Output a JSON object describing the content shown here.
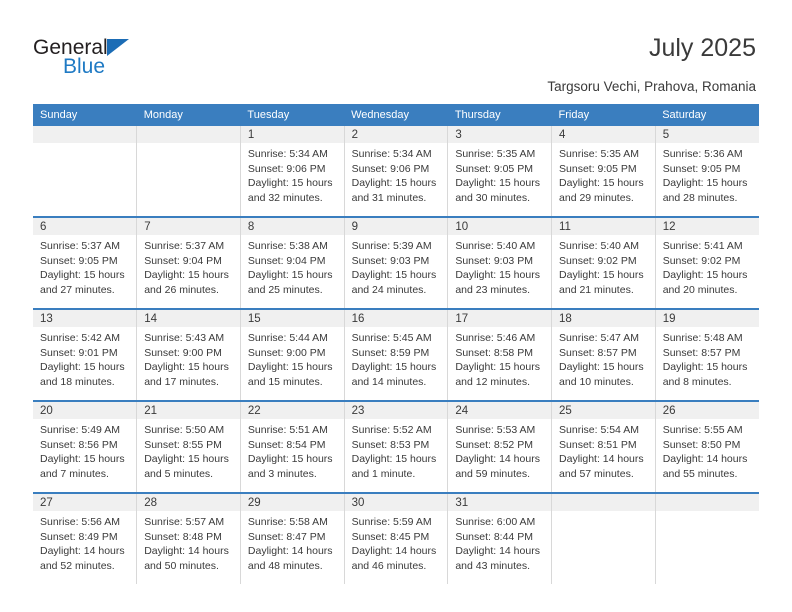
{
  "brand": {
    "name_part1": "General",
    "name_part2": "Blue",
    "triangle_color": "#1b6cb5",
    "blue_color": "#1f7ac4"
  },
  "header": {
    "title": "July 2025",
    "subtitle": "Targsoru Vechi, Prahova, Romania"
  },
  "theme": {
    "header_row_bg": "#3a7ebf",
    "daynum_band_bg": "#f0f0f0",
    "week_separator": "#3a7ebf",
    "cell_border": "#d8d8d8",
    "text_color": "#3a3a3a"
  },
  "labels": {
    "sunrise_prefix": "Sunrise:",
    "sunset_prefix": "Sunset:",
    "daylight_prefix": "Daylight:"
  },
  "weekday_headers": [
    "Sunday",
    "Monday",
    "Tuesday",
    "Wednesday",
    "Thursday",
    "Friday",
    "Saturday"
  ],
  "weeks": [
    [
      {
        "empty": true
      },
      {
        "empty": true
      },
      {
        "day": "1",
        "sunrise": "Sunrise: 5:34 AM",
        "sunset": "Sunset: 9:06 PM",
        "daylight": "Daylight: 15 hours and 32 minutes."
      },
      {
        "day": "2",
        "sunrise": "Sunrise: 5:34 AM",
        "sunset": "Sunset: 9:06 PM",
        "daylight": "Daylight: 15 hours and 31 minutes."
      },
      {
        "day": "3",
        "sunrise": "Sunrise: 5:35 AM",
        "sunset": "Sunset: 9:05 PM",
        "daylight": "Daylight: 15 hours and 30 minutes."
      },
      {
        "day": "4",
        "sunrise": "Sunrise: 5:35 AM",
        "sunset": "Sunset: 9:05 PM",
        "daylight": "Daylight: 15 hours and 29 minutes."
      },
      {
        "day": "5",
        "sunrise": "Sunrise: 5:36 AM",
        "sunset": "Sunset: 9:05 PM",
        "daylight": "Daylight: 15 hours and 28 minutes."
      }
    ],
    [
      {
        "day": "6",
        "sunrise": "Sunrise: 5:37 AM",
        "sunset": "Sunset: 9:05 PM",
        "daylight": "Daylight: 15 hours and 27 minutes."
      },
      {
        "day": "7",
        "sunrise": "Sunrise: 5:37 AM",
        "sunset": "Sunset: 9:04 PM",
        "daylight": "Daylight: 15 hours and 26 minutes."
      },
      {
        "day": "8",
        "sunrise": "Sunrise: 5:38 AM",
        "sunset": "Sunset: 9:04 PM",
        "daylight": "Daylight: 15 hours and 25 minutes."
      },
      {
        "day": "9",
        "sunrise": "Sunrise: 5:39 AM",
        "sunset": "Sunset: 9:03 PM",
        "daylight": "Daylight: 15 hours and 24 minutes."
      },
      {
        "day": "10",
        "sunrise": "Sunrise: 5:40 AM",
        "sunset": "Sunset: 9:03 PM",
        "daylight": "Daylight: 15 hours and 23 minutes."
      },
      {
        "day": "11",
        "sunrise": "Sunrise: 5:40 AM",
        "sunset": "Sunset: 9:02 PM",
        "daylight": "Daylight: 15 hours and 21 minutes."
      },
      {
        "day": "12",
        "sunrise": "Sunrise: 5:41 AM",
        "sunset": "Sunset: 9:02 PM",
        "daylight": "Daylight: 15 hours and 20 minutes."
      }
    ],
    [
      {
        "day": "13",
        "sunrise": "Sunrise: 5:42 AM",
        "sunset": "Sunset: 9:01 PM",
        "daylight": "Daylight: 15 hours and 18 minutes."
      },
      {
        "day": "14",
        "sunrise": "Sunrise: 5:43 AM",
        "sunset": "Sunset: 9:00 PM",
        "daylight": "Daylight: 15 hours and 17 minutes."
      },
      {
        "day": "15",
        "sunrise": "Sunrise: 5:44 AM",
        "sunset": "Sunset: 9:00 PM",
        "daylight": "Daylight: 15 hours and 15 minutes."
      },
      {
        "day": "16",
        "sunrise": "Sunrise: 5:45 AM",
        "sunset": "Sunset: 8:59 PM",
        "daylight": "Daylight: 15 hours and 14 minutes."
      },
      {
        "day": "17",
        "sunrise": "Sunrise: 5:46 AM",
        "sunset": "Sunset: 8:58 PM",
        "daylight": "Daylight: 15 hours and 12 minutes."
      },
      {
        "day": "18",
        "sunrise": "Sunrise: 5:47 AM",
        "sunset": "Sunset: 8:57 PM",
        "daylight": "Daylight: 15 hours and 10 minutes."
      },
      {
        "day": "19",
        "sunrise": "Sunrise: 5:48 AM",
        "sunset": "Sunset: 8:57 PM",
        "daylight": "Daylight: 15 hours and 8 minutes."
      }
    ],
    [
      {
        "day": "20",
        "sunrise": "Sunrise: 5:49 AM",
        "sunset": "Sunset: 8:56 PM",
        "daylight": "Daylight: 15 hours and 7 minutes."
      },
      {
        "day": "21",
        "sunrise": "Sunrise: 5:50 AM",
        "sunset": "Sunset: 8:55 PM",
        "daylight": "Daylight: 15 hours and 5 minutes."
      },
      {
        "day": "22",
        "sunrise": "Sunrise: 5:51 AM",
        "sunset": "Sunset: 8:54 PM",
        "daylight": "Daylight: 15 hours and 3 minutes."
      },
      {
        "day": "23",
        "sunrise": "Sunrise: 5:52 AM",
        "sunset": "Sunset: 8:53 PM",
        "daylight": "Daylight: 15 hours and 1 minute."
      },
      {
        "day": "24",
        "sunrise": "Sunrise: 5:53 AM",
        "sunset": "Sunset: 8:52 PM",
        "daylight": "Daylight: 14 hours and 59 minutes."
      },
      {
        "day": "25",
        "sunrise": "Sunrise: 5:54 AM",
        "sunset": "Sunset: 8:51 PM",
        "daylight": "Daylight: 14 hours and 57 minutes."
      },
      {
        "day": "26",
        "sunrise": "Sunrise: 5:55 AM",
        "sunset": "Sunset: 8:50 PM",
        "daylight": "Daylight: 14 hours and 55 minutes."
      }
    ],
    [
      {
        "day": "27",
        "sunrise": "Sunrise: 5:56 AM",
        "sunset": "Sunset: 8:49 PM",
        "daylight": "Daylight: 14 hours and 52 minutes."
      },
      {
        "day": "28",
        "sunrise": "Sunrise: 5:57 AM",
        "sunset": "Sunset: 8:48 PM",
        "daylight": "Daylight: 14 hours and 50 minutes."
      },
      {
        "day": "29",
        "sunrise": "Sunrise: 5:58 AM",
        "sunset": "Sunset: 8:47 PM",
        "daylight": "Daylight: 14 hours and 48 minutes."
      },
      {
        "day": "30",
        "sunrise": "Sunrise: 5:59 AM",
        "sunset": "Sunset: 8:45 PM",
        "daylight": "Daylight: 14 hours and 46 minutes."
      },
      {
        "day": "31",
        "sunrise": "Sunrise: 6:00 AM",
        "sunset": "Sunset: 8:44 PM",
        "daylight": "Daylight: 14 hours and 43 minutes."
      },
      {
        "empty": true
      },
      {
        "empty": true
      }
    ]
  ]
}
